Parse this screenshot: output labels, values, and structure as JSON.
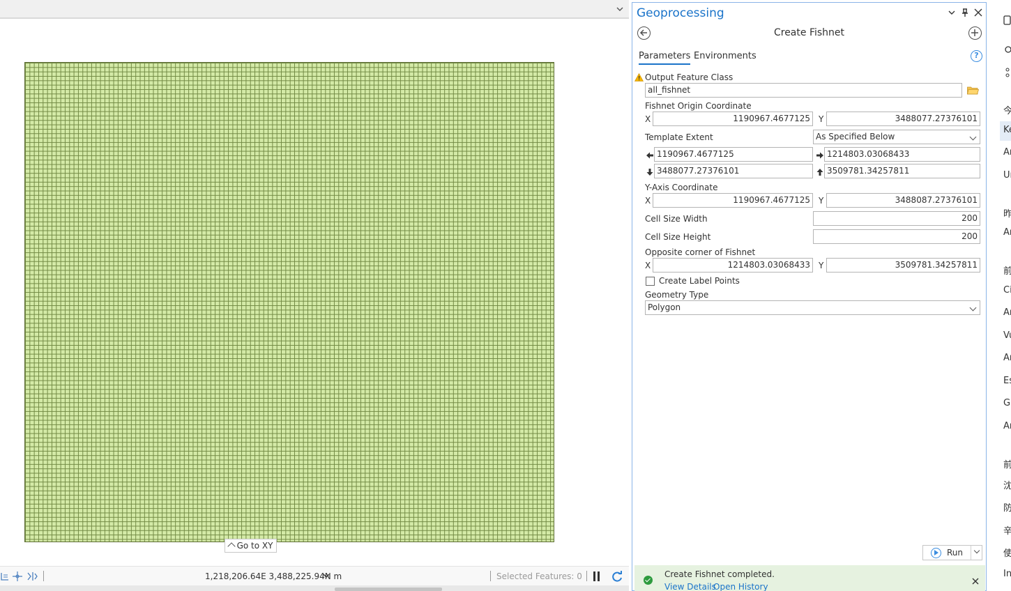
{
  "map": {
    "goto_xy": "Go to XY",
    "coordinates": "1,218,206.64E 3,488,225.94N m",
    "selected_features": "Selected Features: 0"
  },
  "gp": {
    "pane_title": "Geoprocessing",
    "tool_title": "Create Fishnet",
    "tabs": [
      "Parameters",
      "Environments"
    ],
    "output_feature_class": {
      "label": "Output Feature Class",
      "value": "all_fishnet"
    },
    "origin": {
      "label": "Fishnet Origin Coordinate",
      "x_label": "X",
      "x": "1190967.4677125",
      "y_label": "Y",
      "y": "3488077.27376101"
    },
    "template_extent": {
      "label": "Template Extent",
      "selection": "As Specified Below",
      "left": "1190967.4677125",
      "right": "1214803.03068433",
      "bottom": "3488077.27376101",
      "top": "3509781.34257811"
    },
    "y_axis": {
      "label": "Y-Axis Coordinate",
      "x_label": "X",
      "x": "1190967.4677125",
      "y_label": "Y",
      "y": "3488087.27376101"
    },
    "cell_width": {
      "label": "Cell Size Width",
      "value": "200"
    },
    "cell_height": {
      "label": "Cell Size Height",
      "value": "200"
    },
    "opposite": {
      "label": "Opposite corner of Fishnet",
      "x_label": "X",
      "x": "1214803.03068433",
      "y_label": "Y",
      "y": "3509781.34257811"
    },
    "label_points": {
      "label": "Create Label Points",
      "checked": false
    },
    "geometry": {
      "label": "Geometry Type",
      "value": "Polygon"
    },
    "run_label": "Run",
    "status": {
      "message": "Create Fishnet completed.",
      "view_details": "View Details",
      "open_history": "Open History"
    }
  },
  "right_strip": {
    "items": [
      "今",
      "Ke",
      "Ar",
      "Ur",
      "昨",
      "Ar",
      "前",
      "Ci",
      "Ar",
      "Vu",
      "Ar",
      "Es",
      "Gl",
      "Ar",
      "前",
      "沈",
      "防",
      "辛",
      "使",
      "In"
    ]
  },
  "colors": {
    "accent": "#1a73c9",
    "fishnet_fill": "#d4eaa7",
    "fishnet_line": "#728a44",
    "success": "#2e9b3e"
  }
}
